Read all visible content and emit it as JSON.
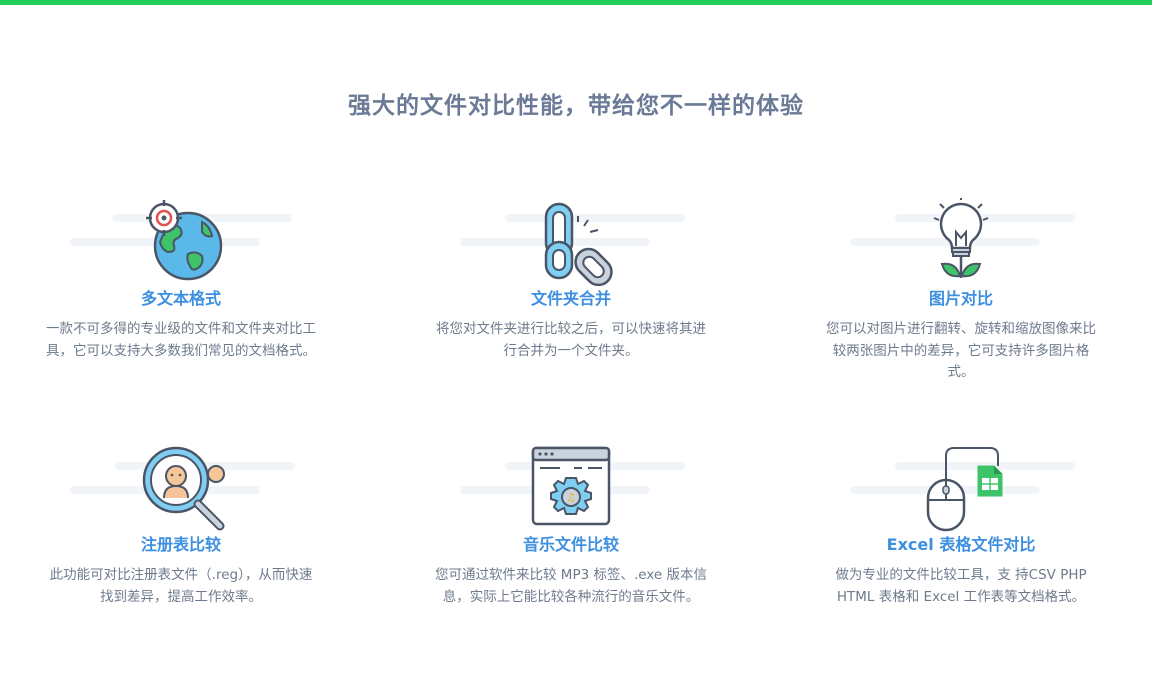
{
  "page": {
    "title": "强大的文件对比性能，带给您不一样的体验"
  },
  "colors": {
    "accent_bar": "#1fcf5a",
    "title": "#6b7a96",
    "feature_title": "#3d8fe0",
    "description": "#6e7b8c"
  },
  "features": [
    {
      "icon": "globe-target-icon",
      "title": "多文本格式",
      "desc_lines": [
        "一款不可多得的专业级的文件和文件夹对比工",
        "具，它可以支持大多数我们常见的文档格式。"
      ]
    },
    {
      "icon": "chain-link-icon",
      "title": "文件夹合并",
      "desc_lines": [
        "将您对文件夹进行比较之后，可以快速将其进",
        "行合并为一个文件夹。"
      ]
    },
    {
      "icon": "lightbulb-icon",
      "title": "图片对比",
      "desc_lines": [
        "您可以对图片进行翻转、旋转和缩放图像来比",
        "较两张图片中的差异，它可支持许多图片格",
        "式。"
      ]
    },
    {
      "icon": "magnifier-faces-icon",
      "title": "注册表比较",
      "desc_lines": [
        "此功能可对比注册表文件（.reg），从而快速",
        "找到差异，提高工作效率。"
      ]
    },
    {
      "icon": "browser-gear-icon",
      "title": "音乐文件比较",
      "desc_lines": [
        "您可通过软件来比较 MP3 标签、.exe 版本信",
        "息，实际上它能比较各种流行的音乐文件。"
      ]
    },
    {
      "icon": "mouse-spreadsheet-icon",
      "title": "Excel 表格文件对比",
      "desc_lines": [
        "做为专业的文件比较工具，支 持CSV PHP",
        "HTML 表格和 Excel 工作表等文档格式。"
      ]
    }
  ]
}
